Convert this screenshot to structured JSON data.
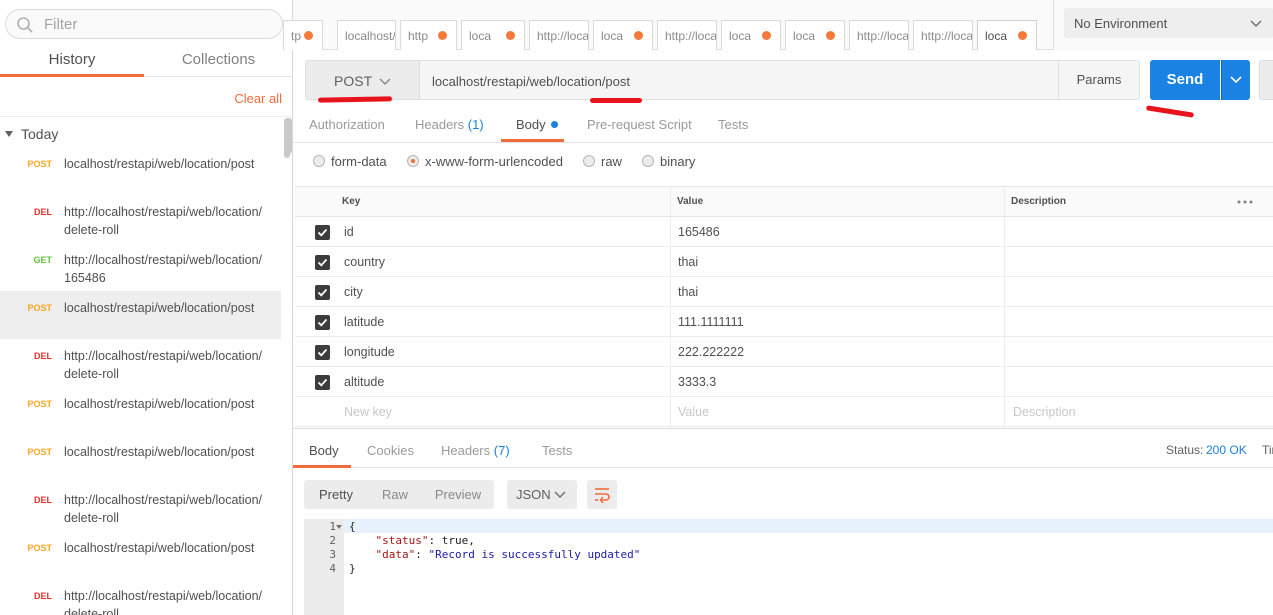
{
  "sidebar": {
    "filter_placeholder": "Filter",
    "tabs": [
      "History",
      "Collections"
    ],
    "clear_all": "Clear all",
    "group_label": "Today",
    "history": [
      {
        "method": "POST",
        "url": "localhost/restapi/web/location/post",
        "color": "#f5a623"
      },
      {
        "method": "DEL",
        "url": "http://localhost/restapi/web/location/delete-roll",
        "color": "#e5322d"
      },
      {
        "method": "GET",
        "url": "http://localhost/restapi/web/location/165486",
        "color": "#60c240"
      },
      {
        "method": "POST",
        "url": "localhost/restapi/web/location/post",
        "color": "#f5a623"
      },
      {
        "method": "DEL",
        "url": "http://localhost/restapi/web/location/delete-roll",
        "color": "#e5322d"
      },
      {
        "method": "POST",
        "url": "localhost/restapi/web/location/post",
        "color": "#f5a623"
      },
      {
        "method": "POST",
        "url": "localhost/restapi/web/location/post",
        "color": "#f5a623"
      },
      {
        "method": "DEL",
        "url": "http://localhost/restapi/web/location/delete-roll",
        "color": "#e5322d"
      },
      {
        "method": "POST",
        "url": "localhost/restapi/web/location/post",
        "color": "#f5a623"
      },
      {
        "method": "DEL",
        "url": "http://localhost/restapi/web/location/delete-roll",
        "color": "#e5322d"
      }
    ]
  },
  "request_tabs": [
    "tp",
    "localhost/",
    "http",
    "loca",
    "http://loca",
    "loca",
    "http://loca",
    "loca",
    "loca",
    "http://loca",
    "http://loca",
    "loca"
  ],
  "environment": {
    "selected": "No Environment"
  },
  "request": {
    "method": "POST",
    "url": "localhost/restapi/web/location/post",
    "params_label": "Params",
    "send_label": "Send"
  },
  "request_subtabs": {
    "authorization": "Authorization",
    "headers": "Headers",
    "headers_count": "(1)",
    "body": "Body",
    "prerequest": "Pre-request Script",
    "tests": "Tests"
  },
  "body_types": {
    "form_data": "form-data",
    "urlencoded": "x-www-form-urlencoded",
    "raw": "raw",
    "binary": "binary",
    "selected": "x-www-form-urlencoded"
  },
  "kv_table": {
    "headers": {
      "key": "Key",
      "value": "Value",
      "description": "Description"
    },
    "rows": [
      {
        "key": "id",
        "value": "165486"
      },
      {
        "key": "country",
        "value": "thai"
      },
      {
        "key": "city",
        "value": "thai"
      },
      {
        "key": "latitude",
        "value": "111.1111111"
      },
      {
        "key": "longitude",
        "value": "222.222222"
      },
      {
        "key": "altitude",
        "value": "3333.3"
      }
    ],
    "placeholders": {
      "key": "New key",
      "value": "Value",
      "description": "Description"
    }
  },
  "response": {
    "tabs": {
      "body": "Body",
      "cookies": "Cookies",
      "headers": "Headers",
      "headers_count": "(7)",
      "tests": "Tests"
    },
    "status_label": "Status:",
    "status_value": "200 OK",
    "time_label": "Time:",
    "view_modes": [
      "Pretty",
      "Raw",
      "Preview"
    ],
    "format": "JSON",
    "code_lines": [
      {
        "num": "1",
        "key": "",
        "value": "",
        "text": "{"
      },
      {
        "num": "2",
        "key": "\"status\"",
        "sep": ": ",
        "value": "true,"
      },
      {
        "num": "3",
        "key": "\"data\"",
        "sep": ": ",
        "value": "\"Record is successfully updated\""
      },
      {
        "num": "4",
        "key": "",
        "value": "",
        "text": "}"
      }
    ]
  },
  "colors": {
    "accent": "#f26b3a",
    "primary": "#1a82e2",
    "annotation": "#e8141b"
  }
}
